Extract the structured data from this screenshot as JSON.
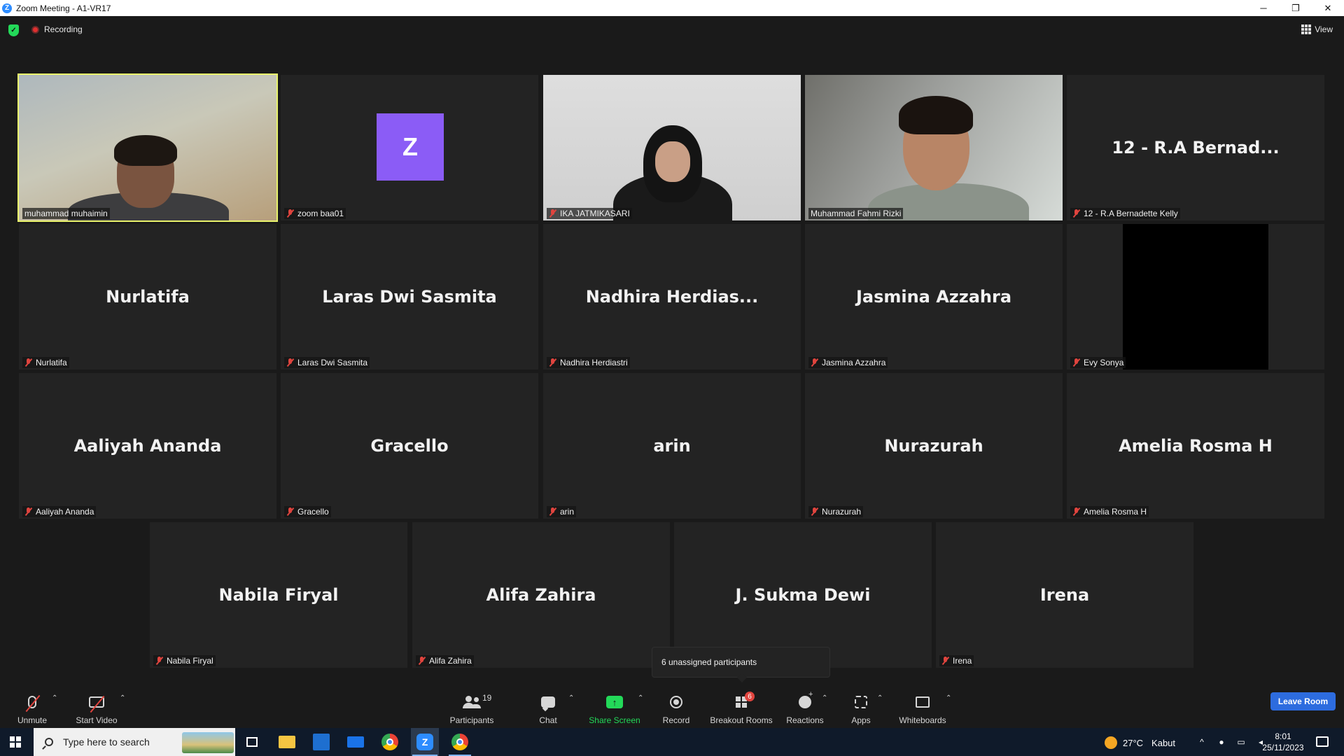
{
  "window": {
    "title": "Zoom Meeting - A1-VR17",
    "app_icon_letter": "Z",
    "controls": {
      "minimize": "─",
      "restore": "❐",
      "close": "✕"
    }
  },
  "meeting": {
    "recording_label": "Recording",
    "view_label": "View",
    "security_glyph": "✓"
  },
  "tiles": [
    {
      "label": "muhammad muhaimin",
      "display": "",
      "muted": false,
      "video": "cam1",
      "active": true
    },
    {
      "label": "zoom baa01",
      "display": "",
      "avatar_letter": "Z",
      "muted": true
    },
    {
      "label": "IKA JATMIKASARI",
      "display": "",
      "muted": true,
      "video": "cam3"
    },
    {
      "label": "Muhammad Fahmi Rizki",
      "display": "",
      "muted": false,
      "video": "cam4"
    },
    {
      "label": "12 - R.A Bernadette Kelly",
      "display": "12 - R.A Bernad...",
      "muted": true
    },
    {
      "label": "Nurlatifa",
      "display": "Nurlatifa",
      "muted": true
    },
    {
      "label": "Laras Dwi Sasmita",
      "display": "Laras Dwi Sasmita",
      "muted": true
    },
    {
      "label": "Nadhira Herdiastri",
      "display": "Nadhira  Herdias...",
      "muted": true
    },
    {
      "label": "Jasmina Azzahra",
      "display": "Jasmina Azzahra",
      "muted": true
    },
    {
      "label": "Evy Sonya",
      "display": "",
      "muted": true,
      "video": "black"
    },
    {
      "label": "Aaliyah Ananda",
      "display": "Aaliyah Ananda",
      "muted": true
    },
    {
      "label": "Gracello",
      "display": "Gracello",
      "muted": true
    },
    {
      "label": "arin",
      "display": "arin",
      "muted": true
    },
    {
      "label": "Nurazurah",
      "display": "Nurazurah",
      "muted": true
    },
    {
      "label": "Amelia Rosma H",
      "display": "Amelia Rosma H",
      "muted": true
    },
    {
      "label": "Nabila Firyal",
      "display": "Nabila Firyal",
      "muted": true
    },
    {
      "label": "Alifa Zahira",
      "display": "Alifa Zahira",
      "muted": true
    },
    {
      "label": "",
      "display": "J. Sukma Dewi",
      "muted": false
    },
    {
      "label": "Irena",
      "display": "Irena",
      "muted": true
    }
  ],
  "tooltip": {
    "text": "6 unassigned participants"
  },
  "toolbar": {
    "unmute": "Unmute",
    "start_video": "Start Video",
    "participants": "Participants",
    "participants_count": "19",
    "chat": "Chat",
    "share_screen": "Share Screen",
    "share_glyph": "↑",
    "record": "Record",
    "breakout_rooms": "Breakout Rooms",
    "breakout_badge": "6",
    "reactions": "Reactions",
    "apps": "Apps",
    "whiteboards": "Whiteboards",
    "caret": "⌃",
    "leave_room": "Leave Room"
  },
  "taskbar": {
    "search_placeholder": "Type here to search",
    "zoom_letter": "Z",
    "temperature": "27°C",
    "weather": "Kabut",
    "tray_up": "^",
    "time": "8:01",
    "date": "25/11/2023"
  },
  "colors": {
    "active_speaker_border": "#e9f36b",
    "share_green": "#23d959",
    "muted_red": "#e0443e",
    "leave_blue": "#2d6cdf",
    "avatar_purple": "#8b5cf6"
  }
}
